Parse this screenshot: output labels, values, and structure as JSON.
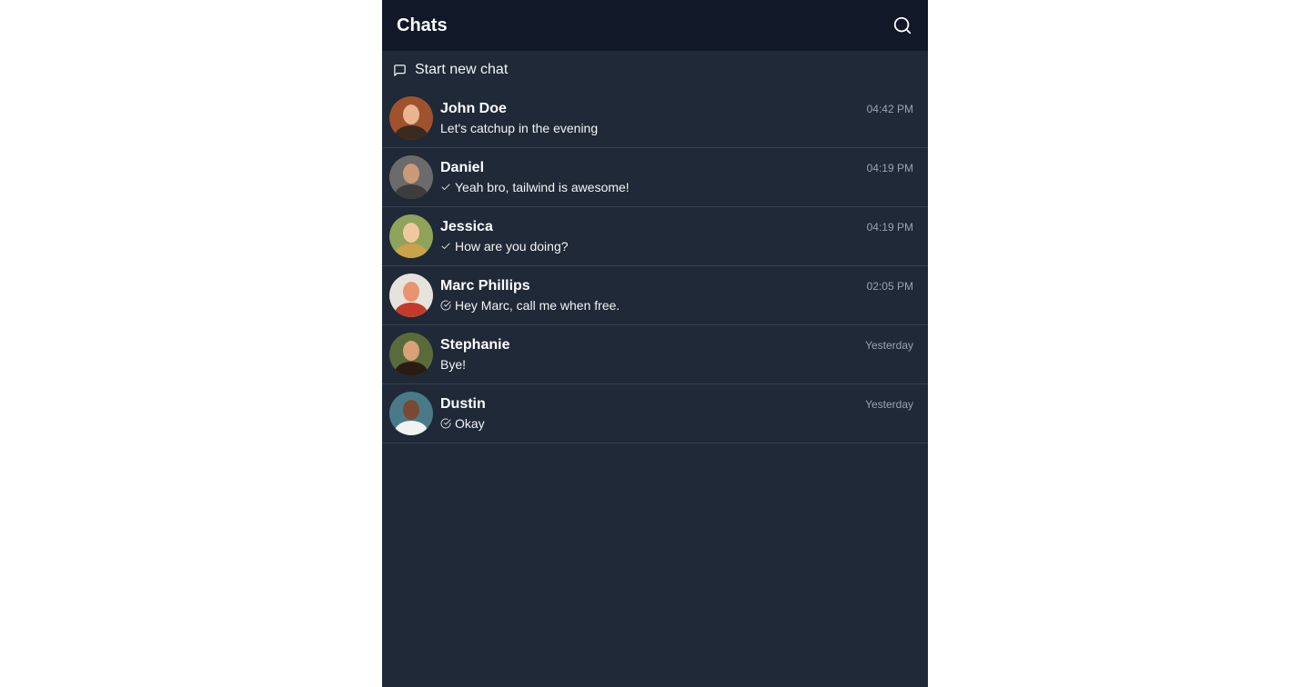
{
  "header": {
    "title": "Chats",
    "search_icon": "search-icon"
  },
  "new_chat": {
    "label": "Start new chat",
    "icon": "message-square-icon"
  },
  "chats": [
    {
      "name": "John Doe",
      "time": "04:42 PM",
      "message": "Let's catchup in the evening",
      "status": "none",
      "avatar_colors": {
        "bg": "#a0522d",
        "face": "#e9b48f",
        "body": "#3b2a20"
      }
    },
    {
      "name": "Daniel",
      "time": "04:19 PM",
      "message": "Yeah bro, tailwind is awesome!",
      "status": "sent",
      "avatar_colors": {
        "bg": "#6b6b6b",
        "face": "#c99a7a",
        "body": "#3d3d3d"
      }
    },
    {
      "name": "Jessica",
      "time": "04:19 PM",
      "message": "How are you doing?",
      "status": "sent",
      "avatar_colors": {
        "bg": "#8fa35a",
        "face": "#f0c8a0",
        "body": "#c9a24a"
      }
    },
    {
      "name": "Marc Phillips",
      "time": "02:05 PM",
      "message": "Hey Marc, call me when free.",
      "status": "read",
      "avatar_colors": {
        "bg": "#e6e2dc",
        "face": "#e89470",
        "body": "#c23b2a"
      }
    },
    {
      "name": "Stephanie",
      "time": "Yesterday",
      "message": "Bye!",
      "status": "none",
      "avatar_colors": {
        "bg": "#5a6b3a",
        "face": "#d9a07a",
        "body": "#2a1c14"
      }
    },
    {
      "name": "Dustin",
      "time": "Yesterday",
      "message": "Okay",
      "status": "read",
      "avatar_colors": {
        "bg": "#4a7a8a",
        "face": "#7a4a30",
        "body": "#f2f2f2"
      }
    }
  ]
}
